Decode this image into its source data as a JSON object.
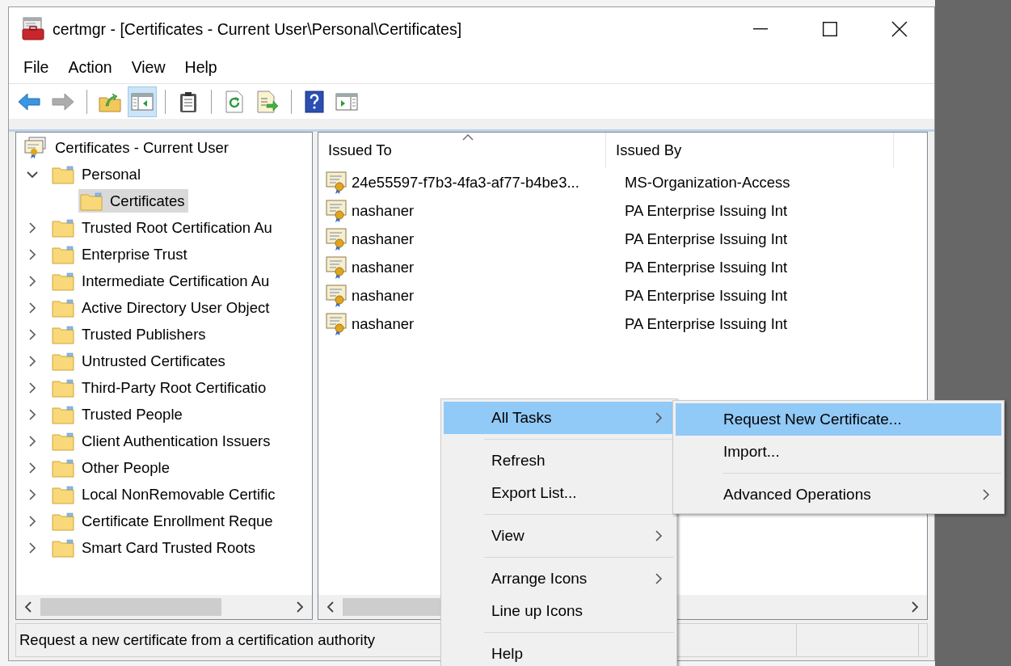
{
  "window": {
    "title": "certmgr - [Certificates - Current User\\Personal\\Certificates]"
  },
  "menu_bar": [
    "File",
    "Action",
    "View",
    "Help"
  ],
  "toolbar": [
    {
      "kind": "back",
      "pressed": false,
      "disabled": false
    },
    {
      "kind": "forward",
      "pressed": false,
      "disabled": true
    },
    {
      "kind": "separator"
    },
    {
      "kind": "up",
      "pressed": false,
      "disabled": false
    },
    {
      "kind": "tree",
      "pressed": true,
      "disabled": false
    },
    {
      "kind": "separator"
    },
    {
      "kind": "clipboard",
      "pressed": false,
      "disabled": false
    },
    {
      "kind": "separator"
    },
    {
      "kind": "refresh",
      "pressed": false,
      "disabled": false
    },
    {
      "kind": "export",
      "pressed": false,
      "disabled": false
    },
    {
      "kind": "separator"
    },
    {
      "kind": "help",
      "pressed": false,
      "disabled": false
    },
    {
      "kind": "pane",
      "pressed": false,
      "disabled": false
    }
  ],
  "tree": {
    "root": {
      "label": "Certificates - Current User"
    },
    "items": [
      {
        "label": "Personal",
        "expanded": true,
        "selected": false,
        "children": [
          {
            "label": "Certificates",
            "selected": true
          }
        ]
      },
      {
        "label": "Trusted Root Certification Au",
        "expanded": false,
        "selected": false
      },
      {
        "label": "Enterprise Trust",
        "expanded": false,
        "selected": false
      },
      {
        "label": "Intermediate Certification Au",
        "expanded": false,
        "selected": false
      },
      {
        "label": "Active Directory User Object",
        "expanded": false,
        "selected": false
      },
      {
        "label": "Trusted Publishers",
        "expanded": false,
        "selected": false
      },
      {
        "label": "Untrusted Certificates",
        "expanded": false,
        "selected": false
      },
      {
        "label": "Third-Party Root Certificatio",
        "expanded": false,
        "selected": false
      },
      {
        "label": "Trusted People",
        "expanded": false,
        "selected": false
      },
      {
        "label": "Client Authentication Issuers",
        "expanded": false,
        "selected": false
      },
      {
        "label": "Other People",
        "expanded": false,
        "selected": false
      },
      {
        "label": "Local NonRemovable Certific",
        "expanded": false,
        "selected": false
      },
      {
        "label": "Certificate Enrollment Reque",
        "expanded": false,
        "selected": false
      },
      {
        "label": "Smart Card Trusted Roots",
        "expanded": false,
        "selected": false
      }
    ]
  },
  "list": {
    "columns": [
      {
        "label": "Issued To",
        "sorted": true
      },
      {
        "label": "Issued By",
        "sorted": false
      }
    ],
    "rows": [
      {
        "issued_to": "24e55597-f7b3-4fa3-af77-b4be3...",
        "issued_by": "MS-Organization-Access"
      },
      {
        "issued_to": "nashaner",
        "issued_by": "PA Enterprise Issuing Int"
      },
      {
        "issued_to": "nashaner",
        "issued_by": "PA Enterprise Issuing Int"
      },
      {
        "issued_to": "nashaner",
        "issued_by": "PA Enterprise Issuing Int"
      },
      {
        "issued_to": "nashaner",
        "issued_by": "PA Enterprise Issuing Int"
      },
      {
        "issued_to": "nashaner",
        "issued_by": "PA Enterprise Issuing Int"
      }
    ]
  },
  "context_menu": {
    "items": [
      {
        "kind": "item",
        "label": "All Tasks",
        "selected": true,
        "submenu": true
      },
      {
        "kind": "separator"
      },
      {
        "kind": "item",
        "label": "Refresh",
        "selected": false,
        "submenu": false
      },
      {
        "kind": "item",
        "label": "Export List...",
        "selected": false,
        "submenu": false
      },
      {
        "kind": "separator"
      },
      {
        "kind": "item",
        "label": "View",
        "selected": false,
        "submenu": true
      },
      {
        "kind": "separator"
      },
      {
        "kind": "item",
        "label": "Arrange Icons",
        "selected": false,
        "submenu": true
      },
      {
        "kind": "item",
        "label": "Line up Icons",
        "selected": false,
        "submenu": false
      },
      {
        "kind": "separator"
      },
      {
        "kind": "item",
        "label": "Help",
        "selected": false,
        "submenu": false
      }
    ]
  },
  "submenu": {
    "items": [
      {
        "kind": "item",
        "label": "Request New Certificate...",
        "selected": true,
        "submenu": false
      },
      {
        "kind": "item",
        "label": "Import...",
        "selected": false,
        "submenu": false
      },
      {
        "kind": "separator"
      },
      {
        "kind": "item",
        "label": "Advanced Operations",
        "selected": false,
        "submenu": true
      }
    ]
  },
  "status_bar": {
    "text": "Request a new certificate from a certification authority"
  }
}
